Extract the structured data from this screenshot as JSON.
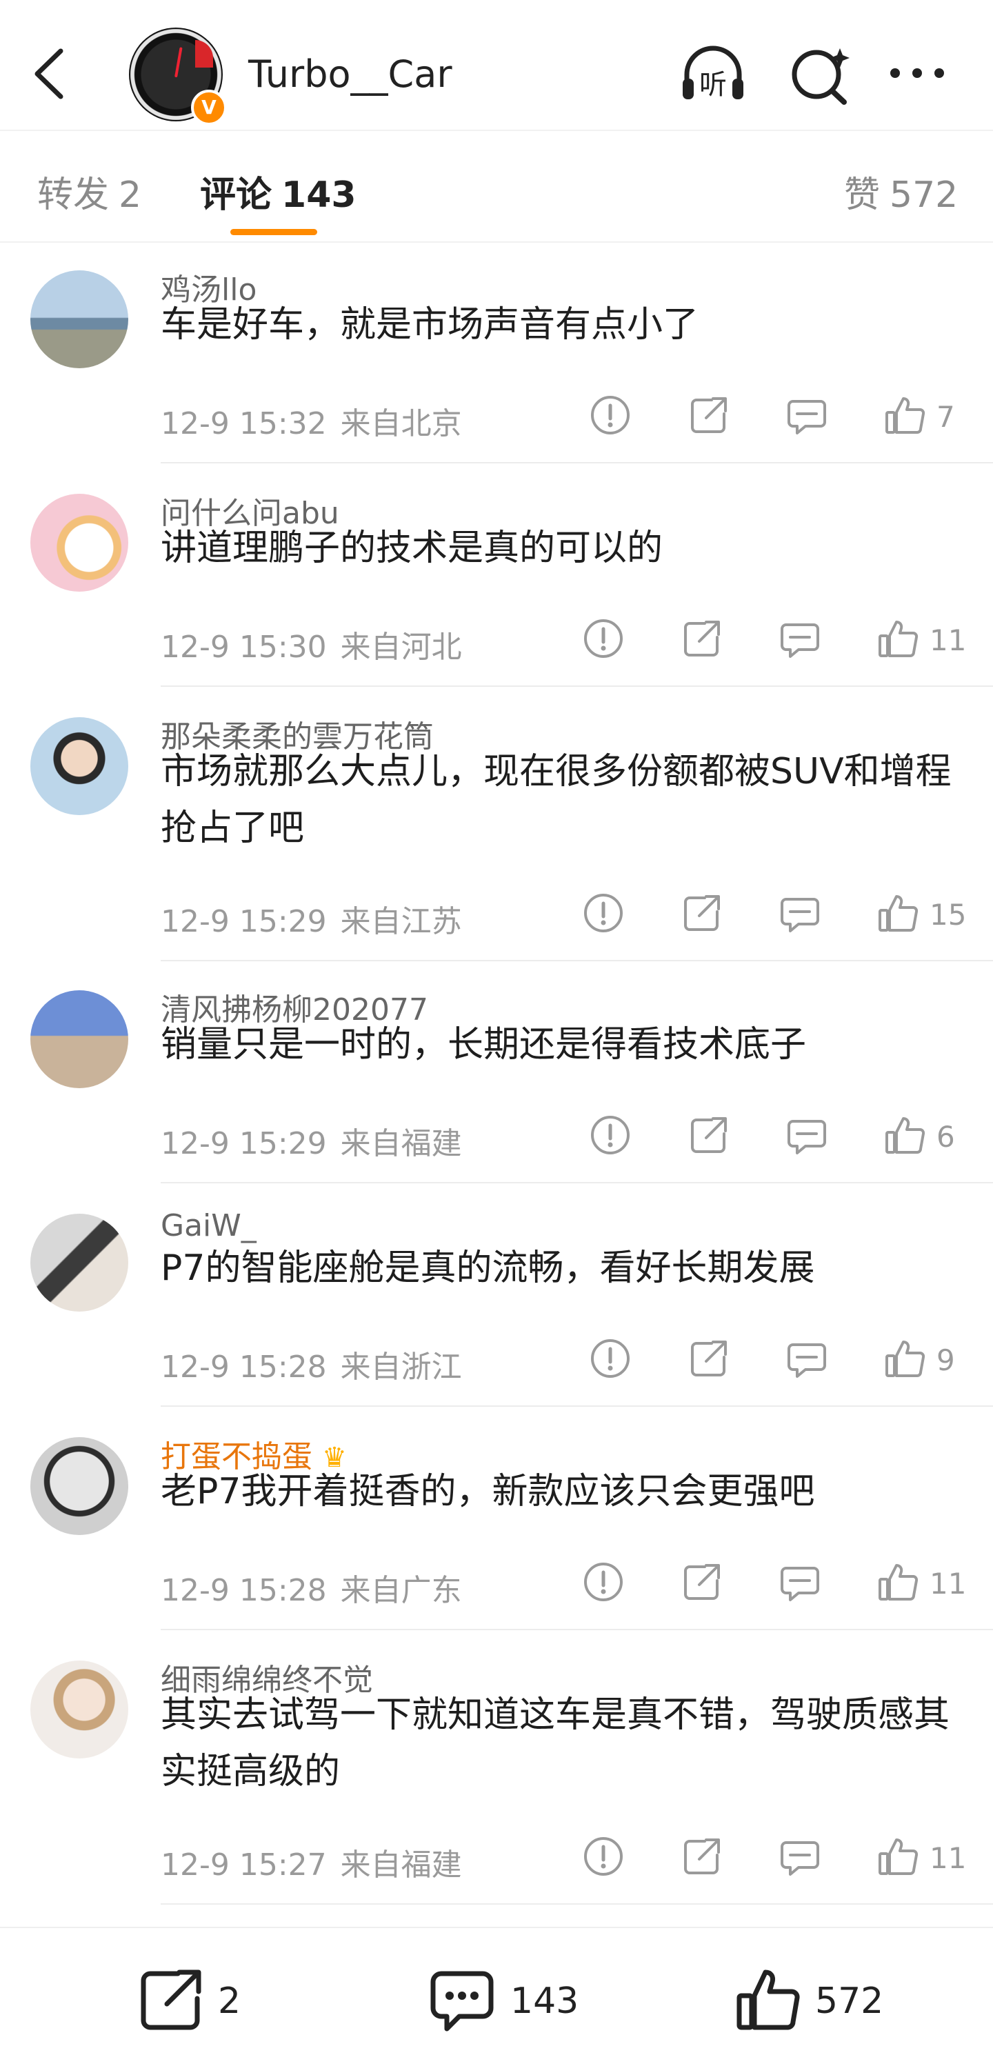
{
  "header": {
    "account_name": "Turbo__Car",
    "verified_badge": "V",
    "icons": [
      "back-icon",
      "listen-icon",
      "search-icon",
      "more-icon"
    ],
    "listen_glyph": "听"
  },
  "tabs": [
    {
      "label": "转发",
      "count": "2"
    },
    {
      "label": "评论",
      "count": "143"
    },
    {
      "label": "赞",
      "count": "572"
    }
  ],
  "colors": {
    "accent": "#ff8a00",
    "vip_name": "#e8760c",
    "meta": "#9a9a9a"
  },
  "comments": [
    {
      "user": "鸡汤llo",
      "text": "车是好车，就是市场声音有点小了",
      "time": "12-9 15:32",
      "location": "来自北京",
      "likes": "7"
    },
    {
      "user": "问什么问abu",
      "text": "讲道理鹏子的技术是真的可以的",
      "time": "12-9 15:30",
      "location": "来自河北",
      "likes": "11"
    },
    {
      "user": "那朵柔柔的雲万花筒",
      "text": "市场就那么大点儿，现在很多份额都被SUV和增程抢占了吧",
      "time": "12-9 15:29",
      "location": "来自江苏",
      "likes": "15"
    },
    {
      "user": "清风拂杨柳202077",
      "text": "销量只是一时的，长期还是得看技术底子",
      "time": "12-9 15:29",
      "location": "来自福建",
      "likes": "6"
    },
    {
      "user": "GaiW_",
      "text": "P7的智能座舱是真的流畅，看好长期发展",
      "time": "12-9 15:28",
      "location": "来自浙江",
      "likes": "9"
    },
    {
      "user": "打蛋不捣蛋",
      "text": "老P7我开着挺香的，新款应该只会更强吧",
      "time": "12-9 15:28",
      "location": "来自广东",
      "likes": "11",
      "vip": true
    },
    {
      "user": "细雨绵绵终不觉",
      "text": "其实去试驾一下就知道这车是真不错，驾驶质感其实挺高级的",
      "time": "12-9 15:27",
      "location": "来自福建",
      "likes": "11"
    }
  ],
  "bottom_bar": {
    "repost_count": "2",
    "comment_count": "143",
    "like_count": "572"
  }
}
